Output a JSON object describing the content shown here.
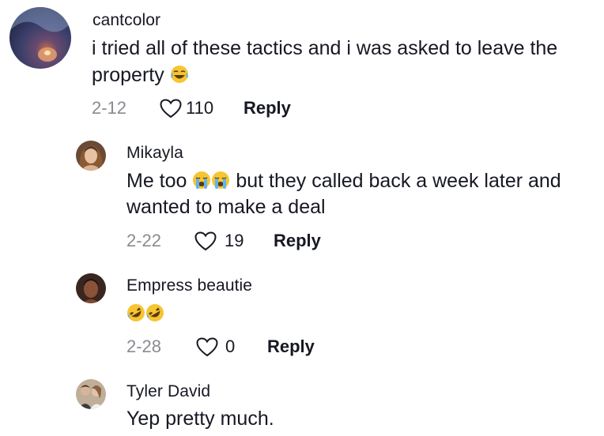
{
  "comments": [
    {
      "username": "cantcolor",
      "line1": "i tried all of these tactics and i was asked to leave the",
      "line2": "property",
      "line2_emoji": "laughing-crying-emoji",
      "date": "2-12",
      "likes": "110",
      "reply_label": "Reply"
    },
    {
      "username": "Mikayla",
      "line1_before": "Me too",
      "line1_emojis": [
        "loudly-crying-emoji",
        "loudly-crying-emoji"
      ],
      "line1_after": "but they called back a week later and",
      "line2": "wanted to make a deal",
      "date": "2-22",
      "likes": "19",
      "reply_label": "Reply"
    },
    {
      "username": "Empress beautie",
      "emojis": [
        "rolling-on-floor-laughing-emoji",
        "rolling-on-floor-laughing-emoji"
      ],
      "date": "2-28",
      "likes": "0",
      "reply_label": "Reply"
    },
    {
      "username": "Tyler David",
      "line1": "Yep pretty much."
    }
  ],
  "colors": {
    "text": "#161823",
    "meta": "#8a8b91",
    "emoji_yellow": "#f7c531",
    "tear_blue": "#5fb4f0"
  }
}
